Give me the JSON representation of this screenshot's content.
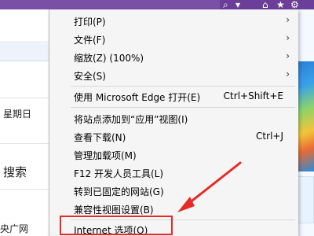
{
  "left_background": {
    "partial_title": "个",
    "weekday": "星期日",
    "search": "搜索",
    "site": "央广网"
  },
  "menu": {
    "items": [
      {
        "label": "打印(P)",
        "submenu": true
      },
      {
        "label": "文件(F)",
        "submenu": true
      },
      {
        "label": "缩放(Z) (100%)",
        "submenu": true
      },
      {
        "label": "安全(S)",
        "submenu": true
      },
      {
        "label": "使用 Microsoft Edge 打开(E)",
        "shortcut": "Ctrl+Shift+E"
      },
      {
        "label": "将站点添加到“应用”视图(I)"
      },
      {
        "label": "查看下载(N)",
        "shortcut": "Ctrl+J"
      },
      {
        "label": "管理加载项(M)"
      },
      {
        "label": "F12 开发人员工具(L)"
      },
      {
        "label": "转到已固定的网站(G)"
      },
      {
        "label": "兼容性视图设置(B)"
      },
      {
        "label": "Internet 选项(O)"
      }
    ]
  },
  "annotation": {
    "color": "#e52a2a"
  },
  "icons": [
    "search-icon",
    "home-icon",
    "star-icon",
    "gear-icon",
    "chevron-right-icon"
  ]
}
